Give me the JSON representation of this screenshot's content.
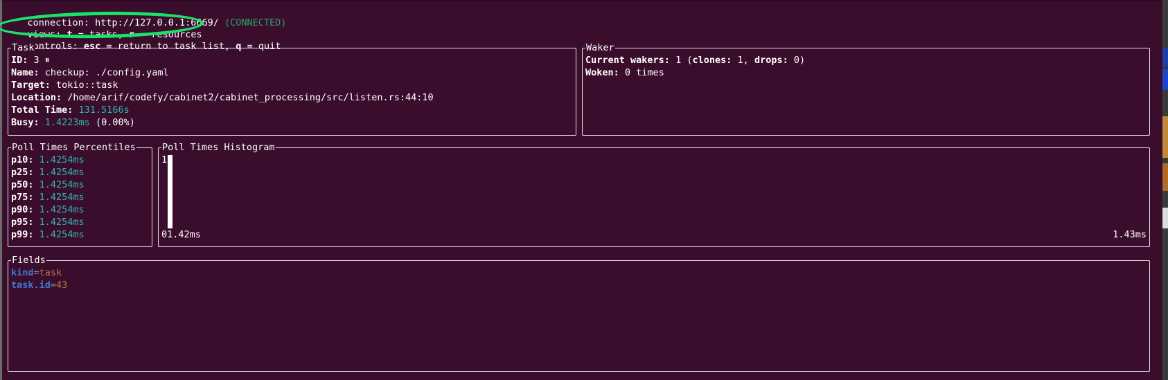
{
  "header": {
    "connection_label": "connection:",
    "connection_url": "http://127.0.0.1:6669/",
    "connection_status": "(CONNECTED)",
    "views_label": "views:",
    "views_t_key": "t",
    "views_t_text": "= tasks,",
    "views_r_key": "r",
    "views_r_text": "= resources",
    "controls_label": "controls:",
    "controls_esc_key": "esc",
    "controls_esc_text": "= return to task list,",
    "controls_q_key": "q",
    "controls_q_text": "= quit"
  },
  "task": {
    "title": "Task",
    "id_label": "ID:",
    "id_value": "3 ⏸",
    "name_label": "Name:",
    "name_value": "checkup: ./config.yaml",
    "target_label": "Target:",
    "target_value": "tokio::task",
    "location_label": "Location:",
    "location_value": "/home/arif/codefy/cabinet2/cabinet_processing/src/listen.rs:44:10",
    "total_time_label": "Total Time:",
    "total_time_value": "131.5166s",
    "busy_label": "Busy:",
    "busy_value": "1.4223ms",
    "busy_pct": "(0.00%)"
  },
  "waker": {
    "title": "Waker",
    "current_label": "Current wakers:",
    "current_value": "1",
    "clones_open": "(",
    "clones_label": "clones:",
    "clones_value": "1,",
    "drops_label": "drops:",
    "drops_value": "0)",
    "woken_label": "Woken:",
    "woken_value": "0 times"
  },
  "percentiles": {
    "title": "Poll Times Percentiles",
    "rows": [
      {
        "label": "p10:",
        "value": "1.4254ms"
      },
      {
        "label": "p25:",
        "value": "1.4254ms"
      },
      {
        "label": "p50:",
        "value": "1.4254ms"
      },
      {
        "label": "p75:",
        "value": "1.4254ms"
      },
      {
        "label": "p90:",
        "value": "1.4254ms"
      },
      {
        "label": "p95:",
        "value": "1.4254ms"
      },
      {
        "label": "p99:",
        "value": "1.4254ms"
      }
    ]
  },
  "histogram": {
    "title": "Poll Times Histogram",
    "max_label": "1",
    "x_min_label": "01.42ms",
    "x_max_label": "1.43ms",
    "bar_fraction": 1.0
  },
  "fields": {
    "title": "Fields",
    "items": [
      {
        "key": "kind",
        "eq": "=",
        "value": "task"
      },
      {
        "key": "task.id",
        "eq": "=",
        "value": "43"
      }
    ]
  },
  "annotation": {
    "color": "#19e26a",
    "shape": "hand-drawn-ellipse"
  },
  "colors": {
    "background": "#3b0d2c",
    "teal": "#2fb7b0",
    "status_green": "#26a269",
    "field_key_blue": "#3a78d8",
    "field_value_brown": "#b5784a"
  }
}
